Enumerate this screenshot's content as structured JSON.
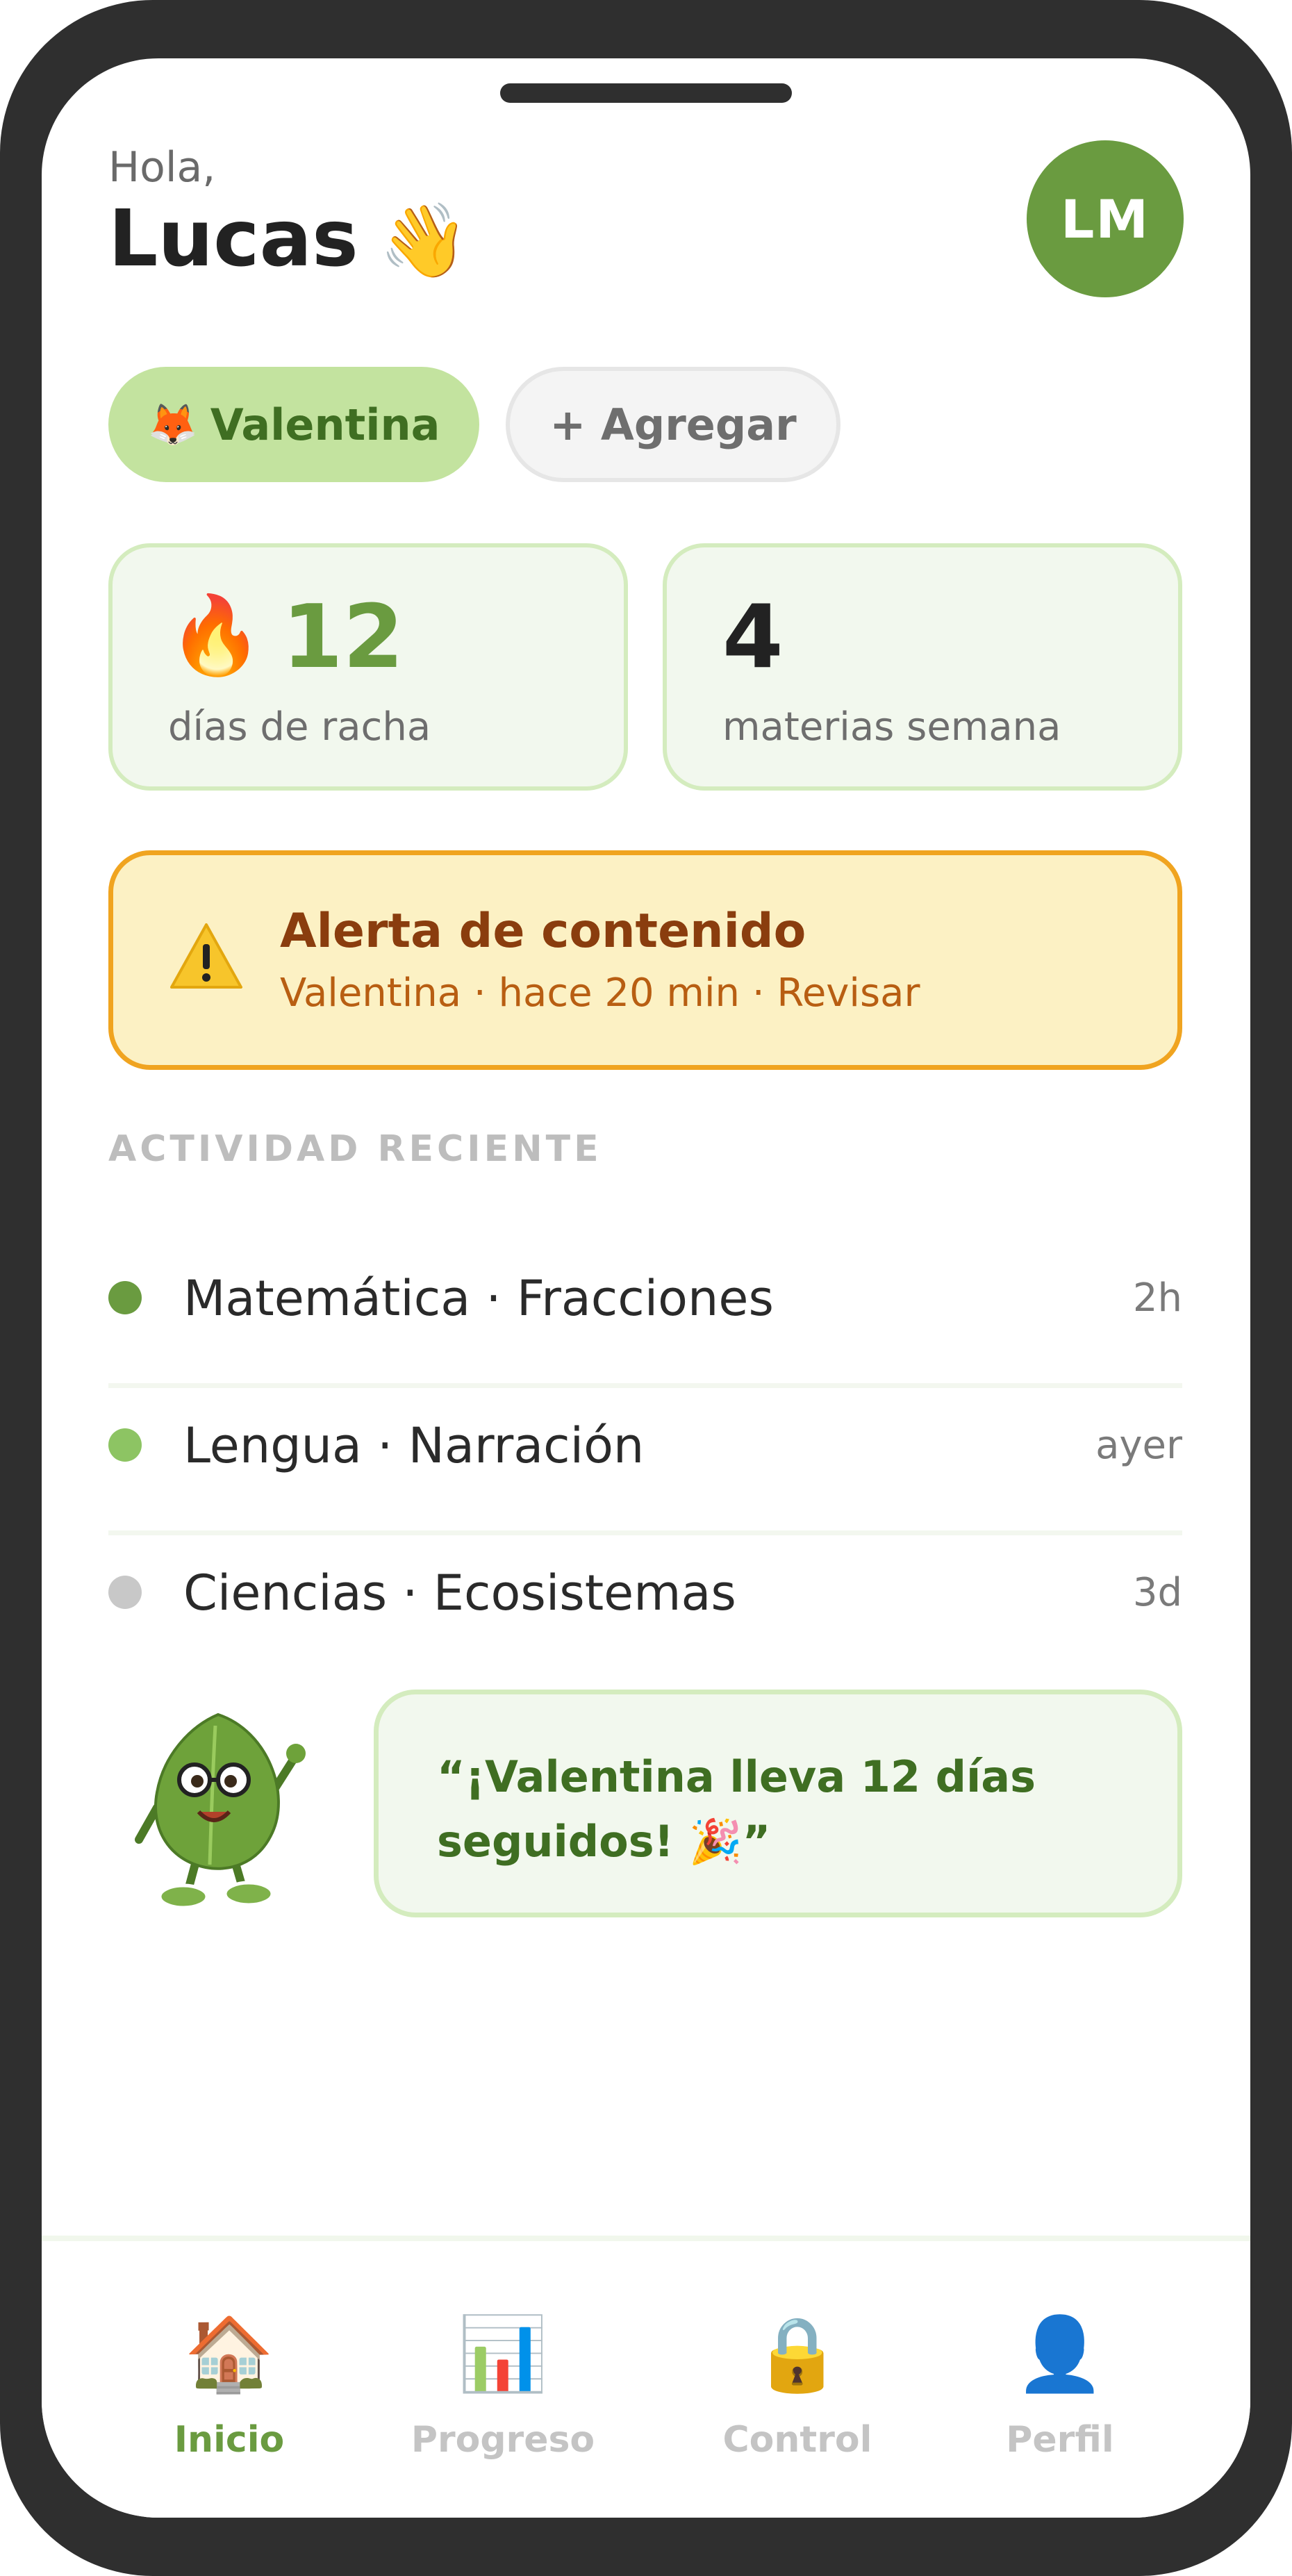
{
  "header": {
    "greeting": "Hola,",
    "name": "Lucas",
    "wave_emoji": "👋",
    "avatar_initials": "LM"
  },
  "chips": {
    "active_icon": "🦊",
    "active_label": "Valentina",
    "add_label": "+ Agregar"
  },
  "stats": {
    "streak_icon": "🔥",
    "streak_value": "12",
    "streak_label": "días de racha",
    "subjects_value": "4",
    "subjects_label": "materias semana"
  },
  "alert": {
    "icon": "warning-icon",
    "title": "Alerta de contenido",
    "subtitle": "Valentina · hace 20 min · Revisar"
  },
  "activity": {
    "section_title": "ACTIVIDAD RECIENTE",
    "items": [
      {
        "label": "Matemática · Fracciones",
        "time": "2h",
        "dot_color": "#6a9b40"
      },
      {
        "label": "Lengua · Narración",
        "time": "ayer",
        "dot_color": "#8dc463"
      },
      {
        "label": "Ciencias · Ecosistemas",
        "time": "3d",
        "dot_color": "#c8c8c8"
      }
    ]
  },
  "mascot": {
    "quote_line1": "“¡Valentina lleva 12 días",
    "quote_line2": "seguidos! 🎉”"
  },
  "nav": {
    "items": [
      {
        "icon": "🏠",
        "label": "Inicio",
        "active": true
      },
      {
        "icon": "📊",
        "label": "Progreso",
        "active": false
      },
      {
        "icon": "🔒",
        "label": "Control",
        "active": false
      },
      {
        "icon": "👤",
        "label": "Perfil",
        "active": false
      }
    ]
  },
  "colors": {
    "brand_green": "#6a9b40",
    "chip_green": "#c3e39f",
    "alert_bg": "#fcf1c4",
    "alert_border": "#f0a420",
    "frame": "#2f2f2f"
  }
}
